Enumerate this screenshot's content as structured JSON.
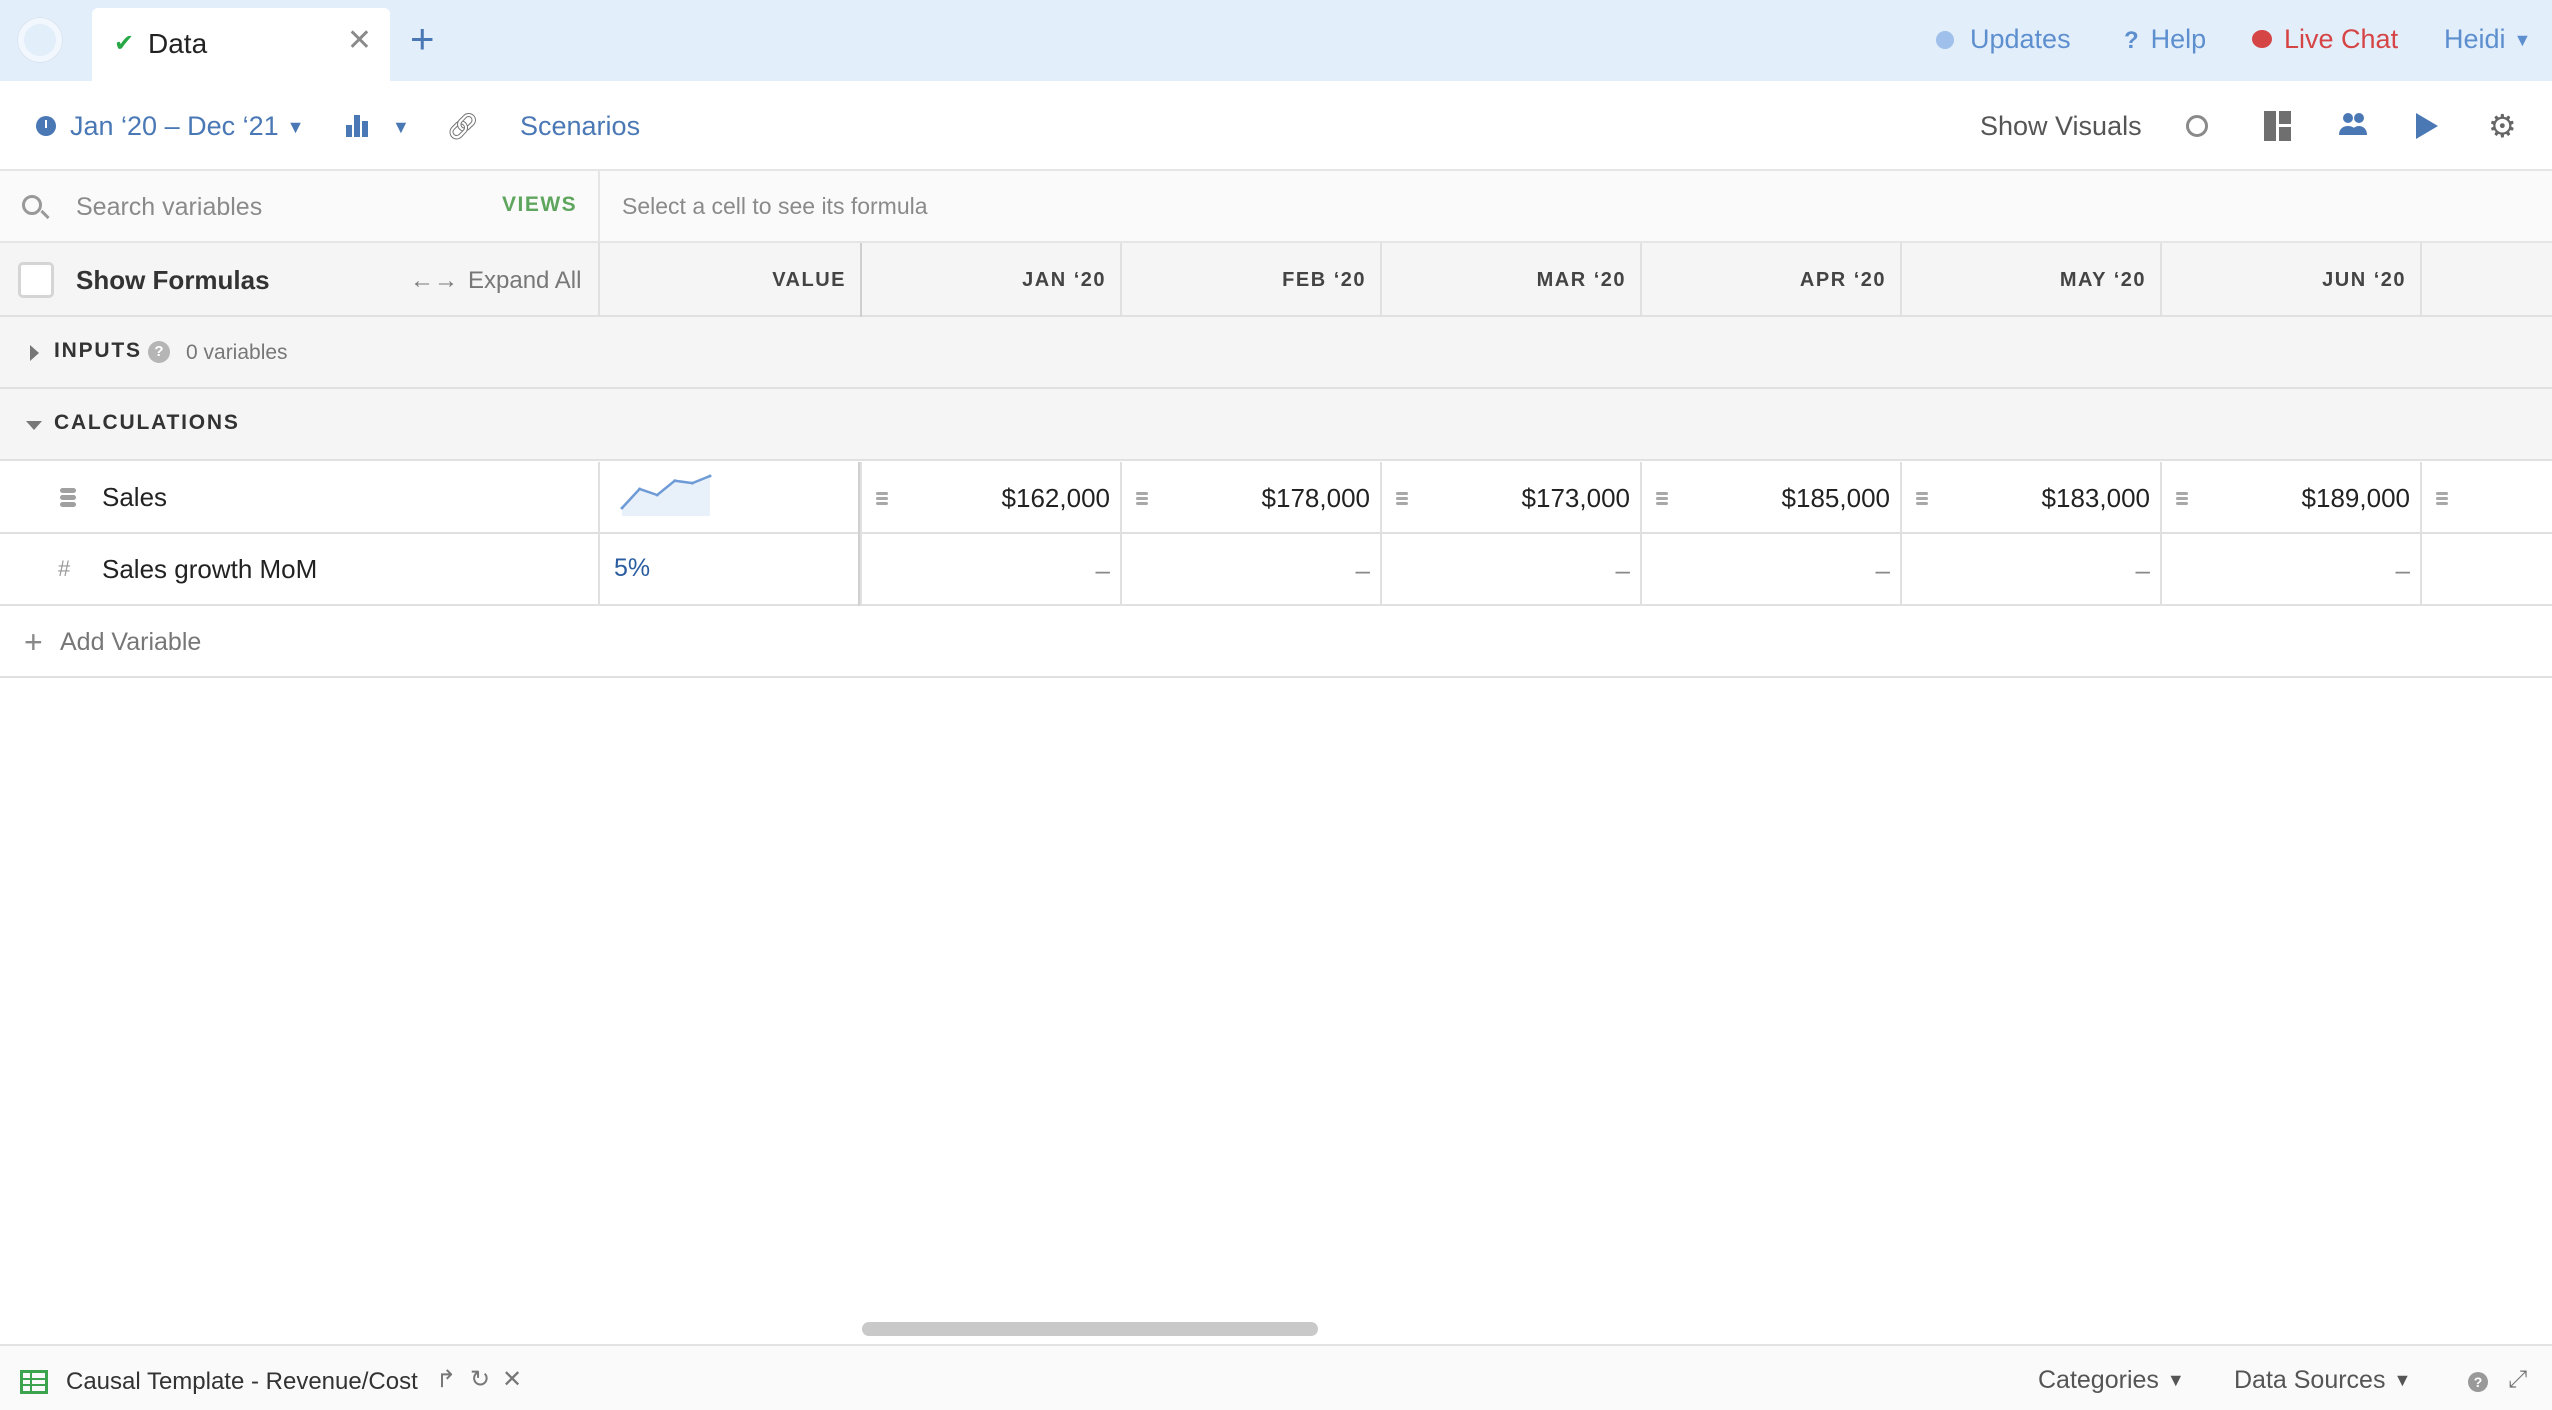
{
  "tabs": {
    "active_label": "Data",
    "close_symbol": "✕",
    "new_symbol": "+"
  },
  "topnav": {
    "updates": "Updates",
    "help": "Help",
    "live_chat": "Live Chat",
    "user": "Heidi"
  },
  "toolbar": {
    "date_range": "Jan ‘20 – Dec ‘21",
    "scenarios": "Scenarios",
    "show_visuals": "Show Visuals"
  },
  "search": {
    "placeholder": "Search variables",
    "views": "VIEWS",
    "formula_hint": "Select a cell to see its formula"
  },
  "grid": {
    "show_formulas": "Show Formulas",
    "expand_all": "Expand All",
    "value_header": "VALUE",
    "months": [
      "JAN ‘20",
      "FEB ‘20",
      "MAR ‘20",
      "APR ‘20",
      "MAY ‘20",
      "JUN ‘20"
    ],
    "groups": {
      "inputs": {
        "label": "INPUTS",
        "count": "0 variables",
        "expanded": false
      },
      "calculations": {
        "label": "CALCULATIONS",
        "expanded": true
      }
    },
    "rows": [
      {
        "name": "Sales",
        "icon": "database-icon",
        "sparkline": [
          162000,
          178000,
          173000,
          185000,
          183000,
          189000
        ],
        "cells": [
          "$162,000",
          "$178,000",
          "$173,000",
          "$185,000",
          "$183,000",
          "$189,000"
        ]
      },
      {
        "name": "Sales growth MoM",
        "icon": "hash-icon",
        "value": "5%",
        "cells": [
          "–",
          "–",
          "–",
          "–",
          "–",
          "–"
        ]
      }
    ],
    "add_variable": "Add Variable"
  },
  "statusbar": {
    "model_name": "Causal Template - Revenue/Cost",
    "categories": "Categories",
    "data_sources": "Data Sources"
  },
  "colors": {
    "accent": "#4a78b5",
    "tab_bar": "#e3eefb",
    "live_chat": "#d64545",
    "views": "#5ea55e",
    "check": "#27a745"
  }
}
